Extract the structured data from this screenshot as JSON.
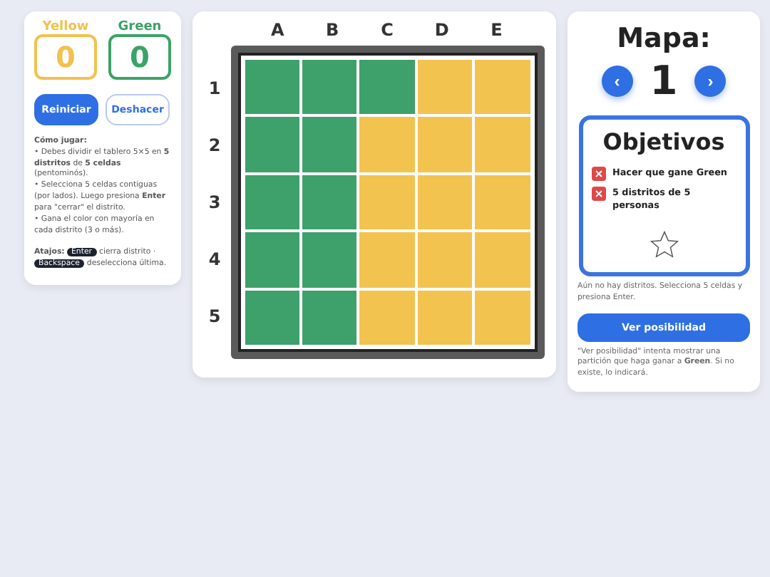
{
  "scores": [
    {
      "label": "Yellow",
      "value": "0",
      "color": "#f2c14e"
    },
    {
      "label": "Green",
      "value": "0",
      "color": "#3aa366"
    }
  ],
  "buttons": [
    {
      "label": "Reiniciar",
      "kind": "primary"
    },
    {
      "label": "Deshacer",
      "kind": "secondary"
    }
  ],
  "how_to": {
    "title": "Cómo jugar:",
    "lines": [
      "• Debes dividir el tablero 5×5 en **5 distritos** de **5 celdas** (pentominós).",
      "• Selecciona 5 celdas contiguas (por lados). Luego presiona **Enter** para \"cerrar\" el distrito.",
      "• Gana el color con mayoría en cada distrito (3 o más)."
    ]
  },
  "shortcuts": {
    "title": "Atajos:",
    "items": [
      {
        "key": "Enter",
        "text": "cierra distrito ·"
      },
      {
        "key": "Backspace",
        "text": "deselecciona última."
      }
    ]
  },
  "board": {
    "columns": [
      "A",
      "B",
      "C",
      "D",
      "E"
    ],
    "rows": [
      "1",
      "2",
      "3",
      "4",
      "5"
    ],
    "cells": [
      [
        {
          "color": "#3ea06a"
        },
        {
          "color": "#3ea06a"
        },
        {
          "color": "#3ea06a"
        },
        {
          "color": "#f3c350"
        },
        {
          "color": "#f3c350"
        }
      ],
      [
        {
          "color": "#3ea06a"
        },
        {
          "color": "#3ea06a"
        },
        {
          "color": "#f3c350"
        },
        {
          "color": "#f3c350"
        },
        {
          "color": "#f3c350"
        }
      ],
      [
        {
          "color": "#3ea06a"
        },
        {
          "color": "#3ea06a"
        },
        {
          "color": "#f3c350"
        },
        {
          "color": "#f3c350"
        },
        {
          "color": "#f3c350"
        }
      ],
      [
        {
          "color": "#3ea06a"
        },
        {
          "color": "#3ea06a"
        },
        {
          "color": "#f3c350"
        },
        {
          "color": "#f3c350"
        },
        {
          "color": "#f3c350"
        }
      ],
      [
        {
          "color": "#3ea06a"
        },
        {
          "color": "#3ea06a"
        },
        {
          "color": "#f3c350"
        },
        {
          "color": "#f3c350"
        },
        {
          "color": "#f3c350"
        }
      ]
    ]
  },
  "map": {
    "title": "Mapa:",
    "prev": "‹",
    "number": "1",
    "next": "›"
  },
  "objectives": {
    "title": "Objetivos",
    "items": [
      {
        "text": "Hacer que gane Green",
        "done": false
      },
      {
        "text": "5 distritos de 5 personas",
        "done": false
      }
    ]
  },
  "status": "Aún no hay distritos. Selecciona 5 celdas y presiona Enter.",
  "show_button": "Ver posibilidad",
  "note": "\"Ver posibilidad\" intenta mostrar una partición que haga ganar a **Green**. Si no existe, lo indicará."
}
